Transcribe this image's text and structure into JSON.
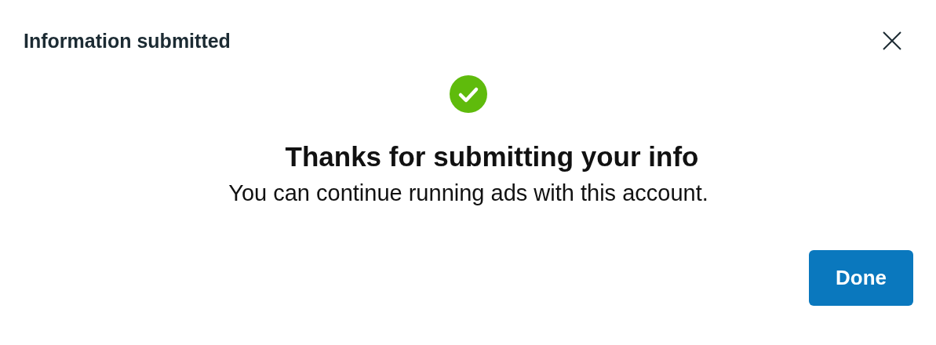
{
  "dialog": {
    "title": "Information submitted",
    "heading": "Thanks for submitting your info",
    "message": "You can continue running ads with this account.",
    "buttons": [
      {
        "label": "Done",
        "kind": "primary"
      }
    ]
  }
}
